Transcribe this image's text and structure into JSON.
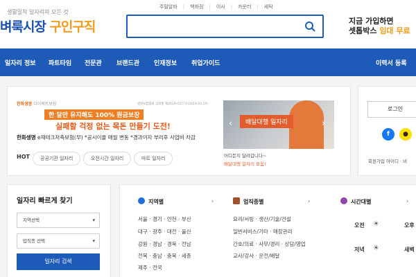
{
  "header": {
    "top_links": [
      "주말알바",
      "백화점",
      "이사",
      "카운터",
      "세탁"
    ],
    "logo_tagline": "생활밀착 일자리의 모든 것",
    "logo_main": "벼룩시장",
    "logo_accent": "구인구직",
    "search_placeholder": "",
    "ad_line1": "지금 가입하면",
    "ad_line2_prefix": "셋톱박스 ",
    "ad_line2_highlight": "임대 무료"
  },
  "nav": {
    "items": [
      "일자리 정보",
      "파트타임",
      "전문관",
      "브랜드관",
      "인재정보",
      "취업가이드"
    ],
    "register": "이력서 등록"
  },
  "banner": {
    "company": "한화생명",
    "company_tag": "다이렉트보험",
    "fine_print": "생명보험협회 심의필 제2019-0377호(2019.03.19)",
    "headline": "한 달만 유지해도 100% 원금보장",
    "subhead": "실패할 걱정 없는 목돈 만들기 도전!",
    "footer_bold": "한화생명",
    "footer_text": " e재테크저축보험(무) *공시이율 매월 변동 *경과이자 부리후 사업비 차감"
  },
  "hot": {
    "label": "HOT",
    "tags": [
      "공공기관 일자리",
      "오전시간 일자리",
      "마트 일자리"
    ]
  },
  "slider": {
    "label": "배달대행 일자리",
    "prev": "‹",
    "next": "›",
    "caption1": "어디든지 달려갑니다~",
    "caption2": "배달대행 일자리 모음!"
  },
  "login": {
    "button": "로그인",
    "links": "회원가입  아이디 · 비"
  },
  "quick": {
    "title": "일자리 빠르게 찾기",
    "region_select": "지역선택",
    "job_select": "업직종 선택",
    "button": "일자리 검색"
  },
  "region": {
    "title": "지역별",
    "more": "›",
    "rows": [
      "서울 · 경기 · 인천 · 부산",
      "대구 · 광주 · 대전 · 울산",
      "강원 · 경남 · 경북 · 전남",
      "전북 · 충남 · 충북 · 세종",
      "제주 · 전국"
    ]
  },
  "job": {
    "title": "업직종별",
    "more": "›",
    "rows": [
      "요리/서빙 · 생산/기술/건설",
      "일반서비스/기타 · 매장관리",
      "간호/의료 · 사무/경리 · 상담/영업",
      "교사/강사 · 운전/배달"
    ]
  },
  "time": {
    "title": "시간대별",
    "more": "›",
    "cells": [
      "오전",
      "오후",
      "저녁",
      "새벽"
    ]
  }
}
